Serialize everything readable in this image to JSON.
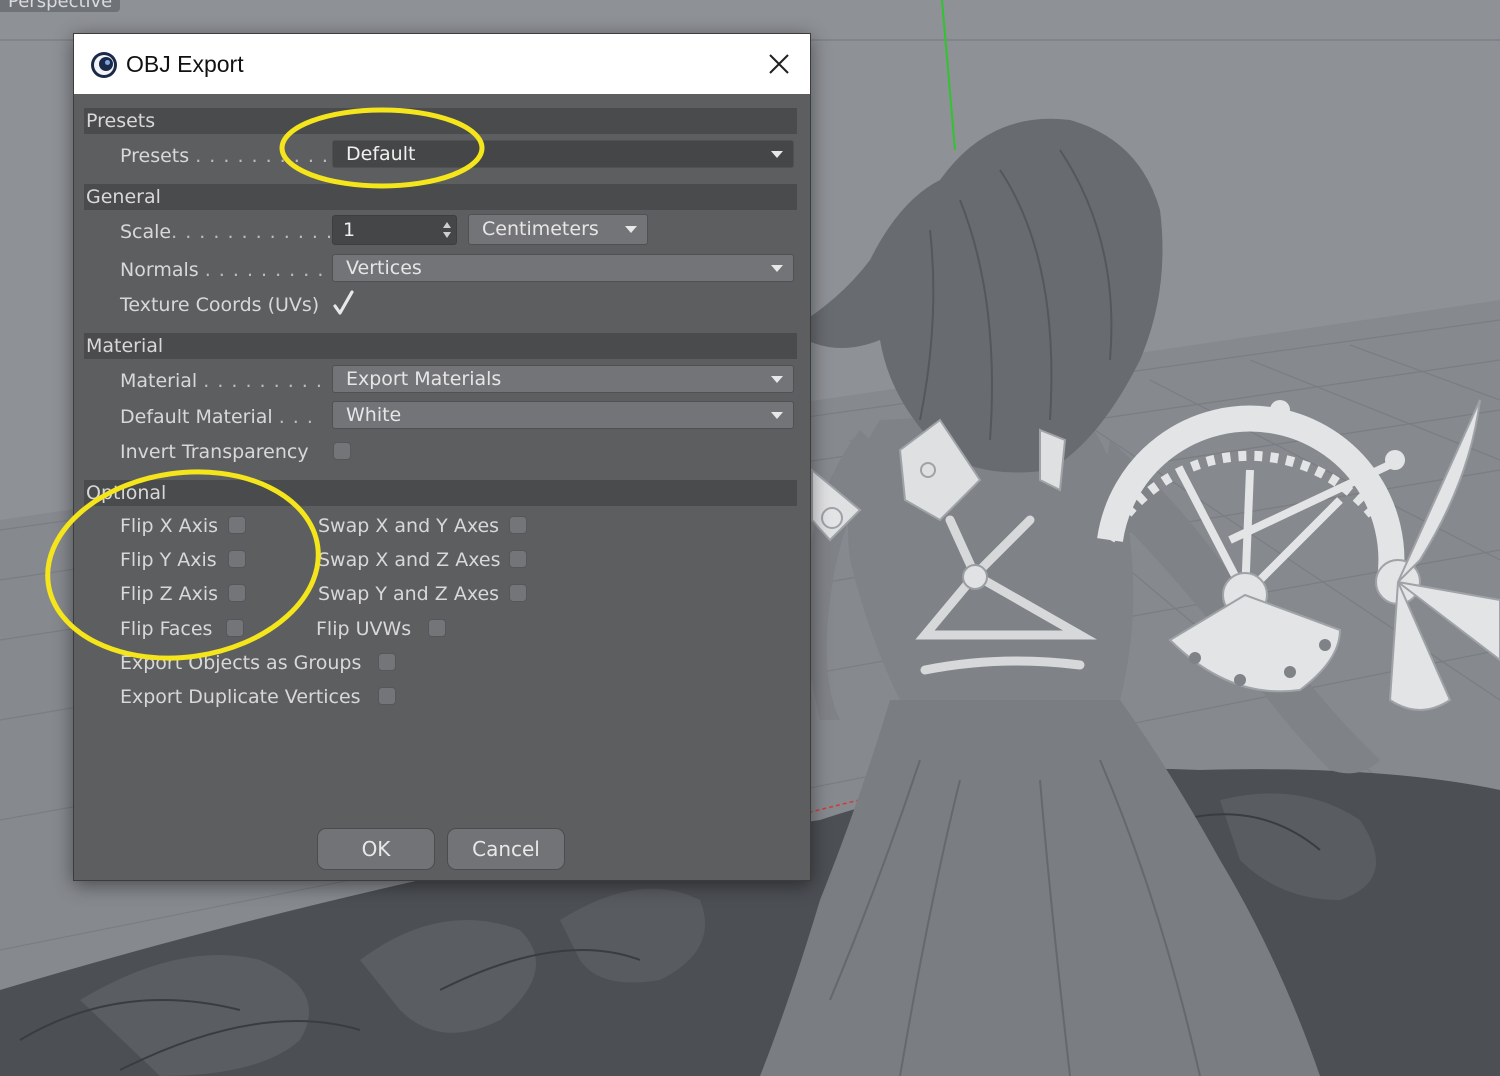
{
  "viewport": {
    "label": "Perspective"
  },
  "dialog": {
    "title": "OBJ Export",
    "presets_section": "Presets",
    "presets_label": "Presets",
    "presets_dots": ". . . . . . . . . .",
    "presets_value": "Default",
    "general_section": "General",
    "scale_label": "Scale",
    "scale_dots": ". . . . . . . . . . . . . .",
    "scale_value": "1",
    "scale_unit": "Centimeters",
    "normals_label": "Normals",
    "normals_dots": ". . . . . . . . . .",
    "normals_value": "Vertices",
    "uv_label": "Texture Coords (UVs)",
    "uv_checked": true,
    "material_section": "Material",
    "material_label": "Material",
    "material_dots": ". . . . . . . . . .",
    "material_value": "Export Materials",
    "default_material_label": "Default Material",
    "default_material_dots": ". . .",
    "default_material_value": "White",
    "invert_transparency_label": "Invert Transparency",
    "optional_section": "Optional",
    "flip_x": "Flip X Axis",
    "flip_y": "Flip Y Axis",
    "flip_z": "Flip Z Axis",
    "flip_faces": "Flip Faces",
    "swap_xy": "Swap X and Y Axes",
    "swap_xz": "Swap X and Z Axes",
    "swap_yz": "Swap Y and Z Axes",
    "flip_uvws": "Flip UVWs",
    "export_groups": "Export Objects as Groups",
    "export_duplicates": "Export Duplicate Vertices",
    "ok": "OK",
    "cancel": "Cancel"
  },
  "colors": {
    "highlight": "#f5e51b",
    "dialog_bg": "#5d5e60",
    "section_bg": "#4a4b4d",
    "axis_green": "#2ec52e",
    "axis_red": "#d23a3a",
    "axis_blue": "#3a3ad2"
  }
}
